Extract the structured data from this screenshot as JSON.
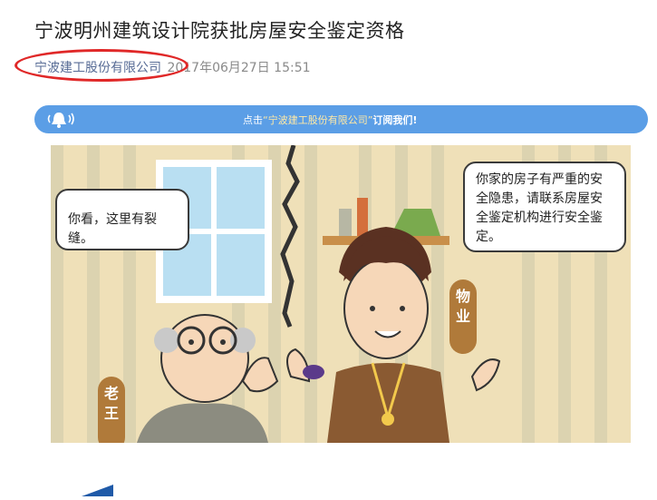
{
  "article": {
    "title": "宁波明州建筑设计院获批房屋安全鉴定资格",
    "author": "宁波建工股份有限公司",
    "datetime": "2017年06月27日 15:51"
  },
  "banner": {
    "prefix": "点击",
    "account": "“宁波建工股份有限公司”",
    "suffix": "订阅我们!"
  },
  "illustration": {
    "left_bubble": "你看，这里有裂缝。",
    "right_bubble": "你家的房子有严重的安全隐患，请联系房屋安全鉴定机构进行安全鉴定。",
    "left_tag": "老王",
    "right_tag": "物业"
  },
  "colors": {
    "link": "#576b95",
    "banner": "#5b9ee6",
    "highlight_circle": "#e02828",
    "illustration_bg": "#efe0b8",
    "tag": "#b07a3a"
  }
}
